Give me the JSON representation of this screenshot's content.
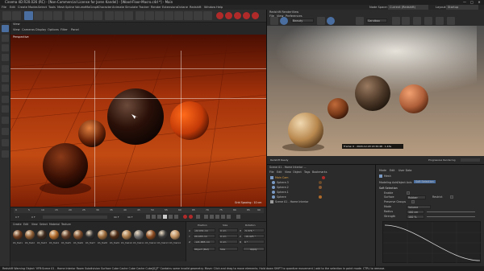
{
  "window": {
    "title": "Cinema 4D R20.026 (RC) - [Non-Commercial License for Joren Kandel] - [Wood-Floor-Macro.c4d *] - Main",
    "controls": [
      "—",
      "□",
      "✕"
    ]
  },
  "menu": [
    "File",
    "Edit",
    "Create",
    "Modes",
    "Select",
    "Tools",
    "Mesh",
    "Spline",
    "Volume",
    "MoGraph",
    "Character",
    "Animate",
    "Simulate",
    "Tracker",
    "Render",
    "Extensions",
    "Octane",
    "Redshift",
    "Window",
    "Help"
  ],
  "node_space": {
    "label": "Node Space:",
    "value": "Current (Redshift)",
    "layout_label": "Layout:",
    "layout_value": "Startup"
  },
  "viewport": {
    "panel_label": "View",
    "menu": [
      "View",
      "Cameras",
      "Display",
      "Options",
      "Filter",
      "Panel"
    ],
    "camera_label": "Perspective",
    "grid_spacing": "Grid Spacing : 10 cm"
  },
  "renderview": {
    "title": "Redshift RenderView",
    "menu": [
      "File",
      "View",
      "Preferences"
    ],
    "display": "Beauty",
    "cam": "Sandbox",
    "frame_info": "Frame: 0 · 2020-12-18 13:30:48 · 1.43s",
    "footer_left": "Redshift Ready",
    "footer_right": "Progressive Rendering"
  },
  "timeline": {
    "ticks": [
      "0",
      "5",
      "10",
      "15",
      "20",
      "25",
      "30",
      "35",
      "40",
      "45",
      "50",
      "55",
      "60",
      "65",
      "70",
      "75",
      "80",
      "85",
      "90"
    ],
    "start": "0 F",
    "current": "0 F",
    "end": "90 F",
    "end2": "90 F"
  },
  "materials": {
    "menu": [
      "Create",
      "Edit",
      "View",
      "Select",
      "Material",
      "Texture"
    ],
    "items": [
      "RS_Mat1",
      "RS_Mat2",
      "RS_Mat3",
      "RS_Mat4",
      "RS_Mat5",
      "RS_Mat6",
      "RS_Mat7",
      "RS_Mat8",
      "RS_Mat9",
      "RS_Mat10",
      "RS_Mat11",
      "RS_Mat12",
      "RS_Mat13",
      "RS_Mat14"
    ],
    "colors": [
      "#6a3a1e",
      "#8a5a32",
      "#3d2a1e",
      "#b06a2a",
      "#5e3a26",
      "#7a4a2a",
      "#2f2f2f",
      "#9a6a3a",
      "#4a2a16",
      "#a87a4a",
      "#6a6a6a",
      "#8a4a20",
      "#3a3a3a",
      "#c09060"
    ]
  },
  "coordinates": {
    "headers": [
      "Position",
      "Size",
      "Rotation"
    ],
    "rows": [
      {
        "axis": "X",
        "pos": "-22.031 cm",
        "size": "0 cm",
        "rot_axis": "H",
        "rot": "-5.376 °"
      },
      {
        "axis": "Y",
        "pos": "20.435 cm",
        "size": "0 cm",
        "rot_axis": "P",
        "rot": "-16.425 °"
      },
      {
        "axis": "Z",
        "pos": "-121.885 cm",
        "size": "0 cm",
        "rot_axis": "B",
        "rot": "0 °"
      }
    ],
    "mode": "Object (Rel)",
    "size_mode": "Size",
    "apply": "Apply"
  },
  "objects": {
    "breadcrumb": "Scene 01 - Home Interior ...",
    "menu": [
      "File",
      "Edit",
      "View",
      "Object",
      "Tags",
      "Bookmarks"
    ],
    "items": [
      "Main Cam",
      "Sphere.3",
      "Sphere.2",
      "Sphere.1",
      "Sphere",
      "Scene 01 - Home Interior"
    ]
  },
  "attributes": {
    "menu": [
      "Mode",
      "Edit",
      "User Data"
    ],
    "object_title": "Mesh",
    "tabs": [
      "Modeling Axis",
      "Object Axis",
      "Soft Selection"
    ],
    "section": "Soft Selection",
    "rows": [
      {
        "label": "Enable",
        "value": ""
      },
      {
        "label": "Surface",
        "value": "Rubber"
      },
      {
        "label": "Restrict",
        "value": ""
      },
      {
        "label": "Preserve Groups",
        "value": ""
      },
      {
        "label": "Mode",
        "value": "Volume"
      },
      {
        "label": "Radius",
        "value": "100 cm"
      },
      {
        "label": "Strength",
        "value": "100 %"
      },
      {
        "label": "Width",
        "value": "50 %"
      },
      {
        "label": "Falloff",
        "value": "Linear"
      }
    ]
  },
  "status": {
    "text": "Redshift Warning Object 'VFR:Scene 01 - Home Interior Room Subdivision Surface Cube Cache Cube Cache Cube[0]/T' Contains some invalid geometry.    Move: Click and drag to move elements. Hold down SHIFT to quantize movement / add to the selection in point mode. CTRL to remove."
  },
  "colors": {
    "accent": "#4a6ea0",
    "record": "#b02a2a",
    "floor": "#8a2a0a"
  }
}
